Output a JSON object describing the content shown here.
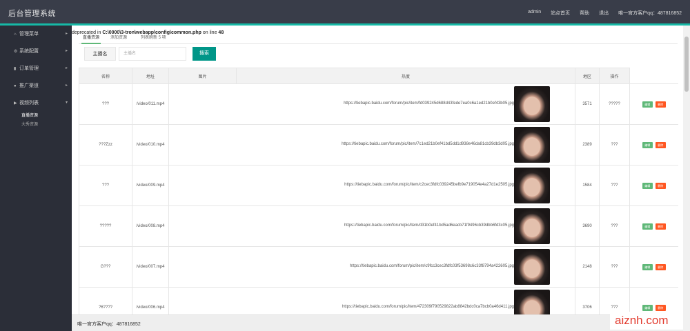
{
  "app": {
    "brand": "后台管理系统",
    "nav": [
      "admin",
      "站点首页",
      "帮助",
      "退出",
      "唯一官方客户qq：487816852"
    ]
  },
  "sidebar": {
    "items": [
      {
        "label": "管理菜单",
        "icon": "home-icon"
      },
      {
        "label": "系统配置",
        "icon": "gear-icon"
      },
      {
        "label": "订单管理",
        "icon": "chart-icon"
      },
      {
        "label": "推广渠道",
        "icon": "user-icon"
      },
      {
        "label": "视频列表",
        "icon": "video-icon"
      }
    ],
    "sub_items": [
      {
        "label": "直播资源",
        "active": true
      },
      {
        "label": "大秀资源",
        "active": false
      }
    ]
  },
  "error": {
    "prefix": "deprecated in ",
    "path": "C:\\0000\\3-tron\\webapp\\config\\common.php",
    "middle": " on line ",
    "line": "48"
  },
  "tabs": [
    "直播资源",
    "添加资源",
    "列表刷新 5 项"
  ],
  "search": {
    "label": "主播名",
    "placeholder": "主播名",
    "button": "搜索"
  },
  "table": {
    "headers": [
      "名称",
      "地址",
      "图片",
      "热度",
      "地区",
      "操作"
    ],
    "edit_label": "编辑",
    "delete_label": "删除",
    "rows": [
      {
        "name": "???",
        "video": "/video/011.mp4",
        "url": "https://tiebapic.baidu.com/forum/pic/item/fd039245d688d43fede7ea0c6a1ed21b0ef43b05.jpg",
        "heat": "3571",
        "region": "?????"
      },
      {
        "name": "???Zzz",
        "video": "/video/010.mp4",
        "url": "https://tiebapic.baidu.com/forum/pic/item/7c1ed21b0ef41bd5dd1d938e46da81cb39db3d05.jpg",
        "heat": "2389",
        "region": "???"
      },
      {
        "name": "???",
        "video": "/video/009.mp4",
        "url": "https://tiebapic.baidu.com/forum/pic/item/c2cec3fdfc039245befb9e719054e4a27d1e2505.jpg",
        "heat": "1584",
        "region": "???"
      },
      {
        "name": "?????",
        "video": "/video/008.mp4",
        "url": "https://tiebapic.baidu.com/forum/pic/item/d31b0ef41bd5ad6eacb71f9496cb39dbb6fd3c05.jpg",
        "heat": "3690",
        "region": "???"
      },
      {
        "name": "G???",
        "video": "/video/007.mp4",
        "url": "https://tiebapic.baidu.com/forum/pic/item/c9fcc3cec3fdfc03f53698c6c33f8794a422605.jpg",
        "heat": "2148",
        "region": "???"
      },
      {
        "name": "?6????",
        "video": "/video/006.mp4",
        "url": "https://tiebapic.baidu.com/forum/pic/item/472309f790529822ab8842bdc0ca7bcb0a46d411.jpg",
        "heat": "3706",
        "region": "???"
      }
    ]
  },
  "footer": {
    "text": "唯一官方客户qq：487816852"
  },
  "watermark": {
    "text": "aiznh.com"
  },
  "colors": {
    "header": "#393d49",
    "sidebar": "#2b2e38",
    "accent": "#009688",
    "edit": "#5fb878",
    "delete": "#ff5722"
  }
}
